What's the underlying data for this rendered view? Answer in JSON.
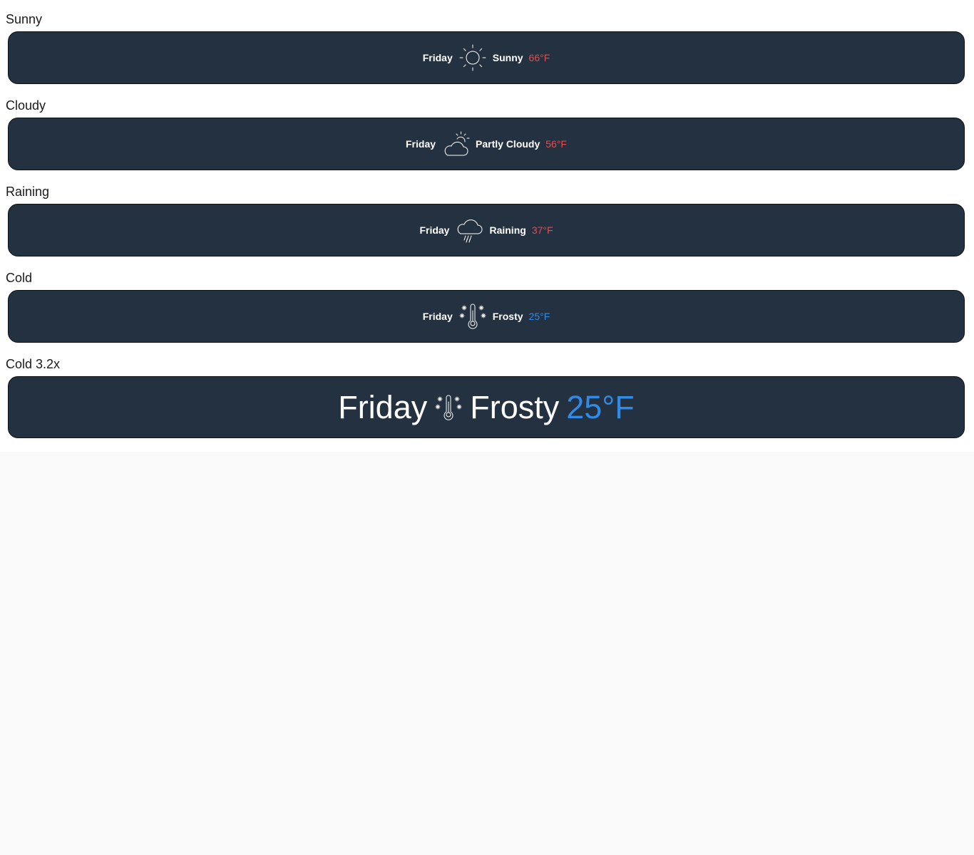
{
  "sections": [
    {
      "label": "Sunny",
      "day": "Friday",
      "icon": "sun-icon",
      "condition": "Sunny",
      "temperature": "66°F",
      "temp_color": "#e84c4c"
    },
    {
      "label": "Cloudy",
      "day": "Friday",
      "icon": "partly-cloudy-icon",
      "condition": "Partly Cloudy",
      "temperature": "56°F",
      "temp_color": "#e84c4c"
    },
    {
      "label": "Raining",
      "day": "Friday",
      "icon": "rain-cloud-icon",
      "condition": "Raining",
      "temperature": "37°F",
      "temp_color": "#e84c4c"
    },
    {
      "label": "Cold",
      "day": "Friday",
      "icon": "frost-thermometer-icon",
      "condition": "Frosty",
      "temperature": "25°F",
      "temp_color": "#2f8ce6"
    },
    {
      "label": "Cold 3.2x",
      "day": "Friday",
      "icon": "frost-thermometer-icon",
      "condition": "Frosty",
      "temperature": "25°F",
      "temp_color": "#2f8ce6"
    }
  ],
  "colors": {
    "card_background": "#243140",
    "page_background": "#f9f9f9",
    "text": "#ffffff"
  }
}
